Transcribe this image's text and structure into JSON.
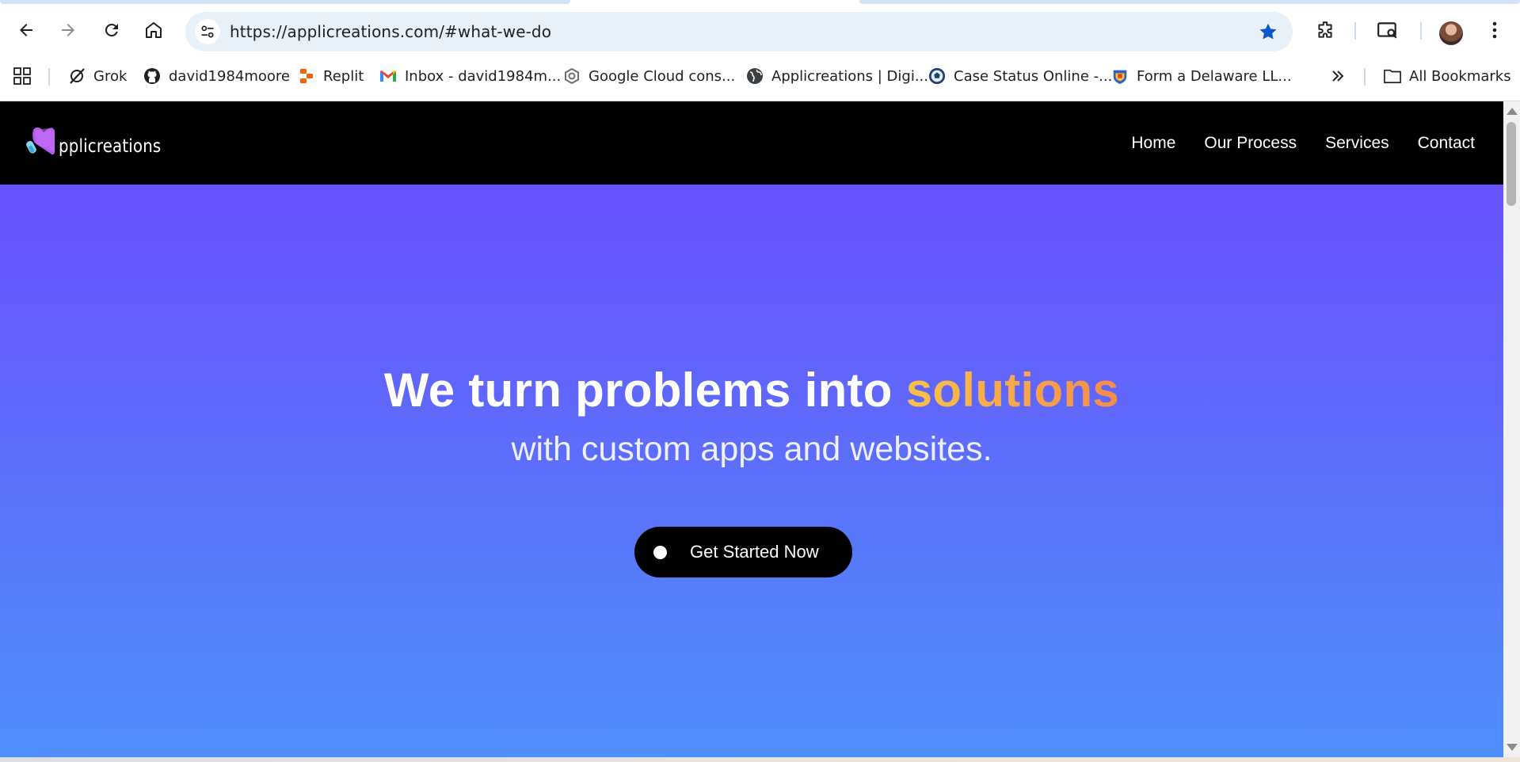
{
  "browser": {
    "url": "https://applicreations.com/#what-we-do",
    "bookmarks": [
      {
        "label": "Grok",
        "icon": "grok-icon"
      },
      {
        "label": "david1984moore",
        "icon": "github-icon"
      },
      {
        "label": "Replit",
        "icon": "replit-icon"
      },
      {
        "label": "Inbox - david1984m...",
        "icon": "gmail-icon"
      },
      {
        "label": "Google Cloud cons...",
        "icon": "google-cloud-icon"
      },
      {
        "label": "Applicreations | Digi...",
        "icon": "globe-icon"
      },
      {
        "label": "Case Status Online -...",
        "icon": "uscis-seal-icon"
      },
      {
        "label": "Form a Delaware LL...",
        "icon": "delaware-icon"
      }
    ],
    "all_bookmarks_label": "All Bookmarks",
    "colors": {
      "star": "#0b57d0",
      "omnibox": "#e8f0f8"
    }
  },
  "site": {
    "logo_text": "pplicreations",
    "nav": [
      "Home",
      "Our Process",
      "Services",
      "Contact"
    ],
    "hero": {
      "title_main": "We turn problems into ",
      "title_accent": "solutions",
      "subtitle": "with custom apps and websites.",
      "cta_label": "Get Started Now"
    },
    "colors": {
      "header_bg": "#000000",
      "hero_top": "#6852fd",
      "hero_bottom": "#4f8efd",
      "accent_start": "#f8c24a",
      "accent_end": "#f48c4b",
      "logo_purple": "#b45cf0"
    }
  }
}
